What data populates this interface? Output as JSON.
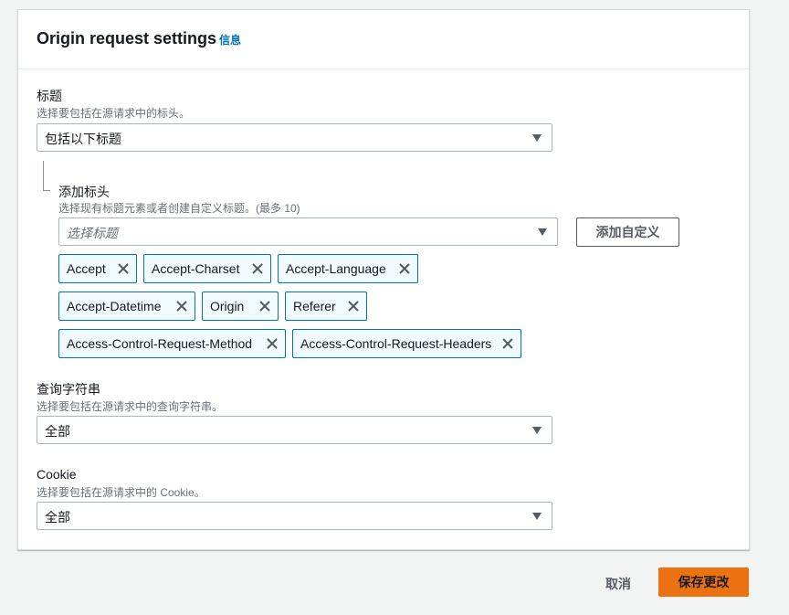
{
  "panel": {
    "title": "Origin request settings",
    "info_link": "信息"
  },
  "headers": {
    "label": "标题",
    "description": "选择要包括在源请求中的标头。",
    "selected": "包括以下标题",
    "add": {
      "label": "添加标头",
      "description": "选择现有标题元素或者创建自定义标题。(最多 10)",
      "placeholder": "选择标题",
      "custom_button": "添加自定义"
    },
    "tags": [
      "Accept",
      "Accept-Charset",
      "Accept-Language",
      "Accept-Datetime",
      "Origin",
      "Referer",
      "Access-Control-Request-Method",
      "Access-Control-Request-Headers"
    ]
  },
  "query_strings": {
    "label": "查询字符串",
    "description": "选择要包括在源请求中的查询字符串。",
    "selected": "全部"
  },
  "cookie": {
    "label": "Cookie",
    "description": "选择要包括在源请求中的 Cookie。",
    "selected": "全部"
  },
  "footer": {
    "cancel": "取消",
    "save": "保存更改"
  },
  "colors": {
    "accent": "#0073bb",
    "primary_button": "#ec7211",
    "tag_background": "#f1faff"
  },
  "icons": {
    "dropdown": "caret-down-icon",
    "tag_remove": "close-icon"
  }
}
